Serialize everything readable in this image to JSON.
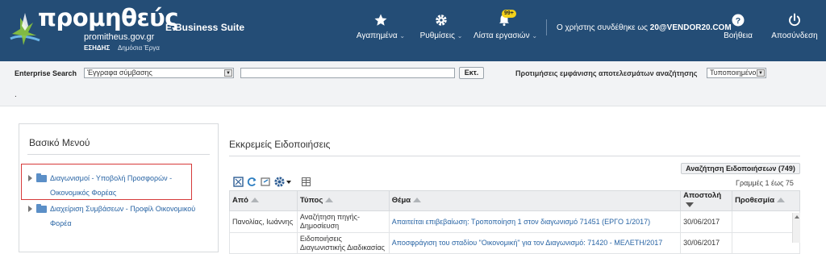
{
  "header": {
    "logo_main": "προμηθεύς",
    "logo_sub": "promitheus.gov.gr",
    "logo_esidis": "ΕΣΗΔΗΣ",
    "logo_dimosia": "Δημόσια Έργα",
    "suite_name": "E-Business Suite",
    "nav": {
      "favorites": "Αγαπημένα",
      "settings": "Ρυθμίσεις",
      "tasks": "Λίστα εργασιών",
      "tasks_badge": "99+",
      "help": "Βοήθεια",
      "logout": "Αποσύνδεση"
    },
    "user_prefix": "Ο χρήστης συνδέθηκε ως",
    "user_name": "20@VENDOR20.COM",
    "colors": {
      "header_bg": "#244d76",
      "badge": "#f4d21a"
    }
  },
  "search": {
    "label": "Enterprise Search",
    "type_value": "Έγγραφα σύμβασης",
    "query_value": "",
    "go_label": "Εκτ.",
    "pref_label": "Προτιμήσεις εμφάνισης αποτελεσμάτων αναζήτησης",
    "pref_value": "Τυποποιημένο",
    "dot": "."
  },
  "menu": {
    "title": "Βασικό Μενού",
    "items": [
      {
        "label": "Διαγωνισμοί - Υποβολή Προσφορών - Οικονομικός Φορέας",
        "icon": "folder-icon",
        "highlighted": true
      },
      {
        "label": "Διαχείριση Συμβάσεων - Προφίλ Οικονομικού Φορέα",
        "icon": "folder-icon",
        "highlighted": false
      }
    ],
    "highlight_color": "#d63a3a"
  },
  "notifications": {
    "title": "Εκκρεμείς Ειδοποιήσεις",
    "search_button": "Αναζήτηση Ειδοποιήσεων (749)",
    "rows_count": "Γραμμές 1 έως 75",
    "columns": [
      "Από",
      "Τύπος",
      "Θέμα",
      "Αποστολή",
      "Προθεσμία"
    ],
    "rows": [
      {
        "from": "Πανολίας, Ιωάννης",
        "type": "Αναζήτηση πηγής-Δημοσίευση",
        "subject": "Απαιτείται επιβεβαίωση: Τροποποίηση 1 στον διαγωνισμό 71451 (ΕΡΓΟ 1/2017)",
        "sent": "30/06/2017",
        "deadline": ""
      },
      {
        "from": "",
        "type": "Ειδοποιήσεις Διαγωνιστικής Διαδικασίας",
        "subject": "Αποσφράγιση του σταδίου \"Οικονομική\" για τον Διαγωνισμό: 71420 - ΜΕΛΕΤΗ/2017",
        "sent": "30/06/2017",
        "deadline": ""
      }
    ]
  }
}
